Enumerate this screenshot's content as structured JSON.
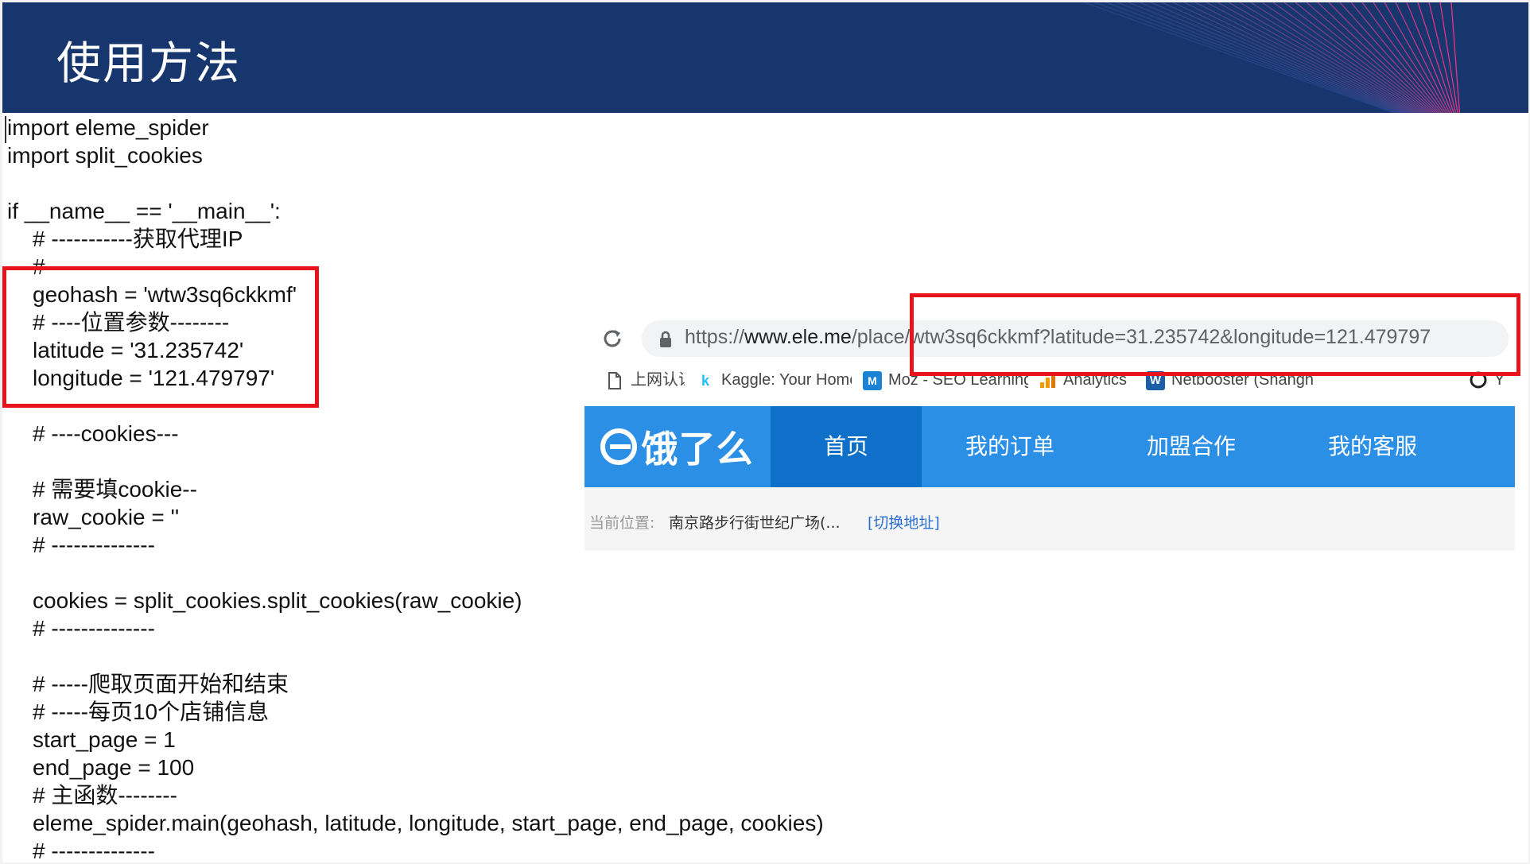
{
  "slide": {
    "title": "使用方法"
  },
  "code": {
    "lines": [
      {
        "text": "import eleme_spider",
        "indent": false
      },
      {
        "text": "import split_cookies",
        "indent": false
      },
      {
        "text": "",
        "indent": false
      },
      {
        "text": "if __name__ == '__main__':",
        "indent": false
      },
      {
        "text": "# -----------获取代理IP",
        "indent": true
      },
      {
        "text": "# -----------",
        "indent": true
      },
      {
        "text": "geohash = 'wtw3sq6ckkmf'",
        "indent": true
      },
      {
        "text": "# ----位置参数--------",
        "indent": true
      },
      {
        "text": "latitude = '31.235742'",
        "indent": true
      },
      {
        "text": "longitude = '121.479797'",
        "indent": true
      },
      {
        "text": "",
        "indent": true
      },
      {
        "text": "# ----cookies---",
        "indent": true
      },
      {
        "text": "",
        "indent": true
      },
      {
        "text": "# 需要填cookie--",
        "indent": true
      },
      {
        "text": "raw_cookie = ''",
        "indent": true
      },
      {
        "text": "# --------------",
        "indent": true
      },
      {
        "text": "",
        "indent": true
      },
      {
        "text": "cookies = split_cookies.split_cookies(raw_cookie)",
        "indent": true
      },
      {
        "text": "# --------------",
        "indent": true
      },
      {
        "text": "",
        "indent": true
      },
      {
        "text": "# -----爬取页面开始和结束",
        "indent": true
      },
      {
        "text": "# -----每页10个店铺信息",
        "indent": true
      },
      {
        "text": "start_page = 1",
        "indent": true
      },
      {
        "text": "end_page = 100",
        "indent": true
      },
      {
        "text": "# 主函数--------",
        "indent": true
      },
      {
        "text": "eleme_spider.main(geohash, latitude, longitude, start_page, end_page, cookies)",
        "indent": true
      },
      {
        "text": "# --------------",
        "indent": true
      }
    ]
  },
  "browser": {
    "url_scheme": "https://",
    "url_host": "www.ele.me",
    "url_path": "/place/wtw3sq6ckkmf?latitude=31.235742&longitude=121.479797",
    "bookmarks": [
      {
        "label": "上网认证",
        "icon": "page-icon"
      },
      {
        "label": "Kaggle: Your Home",
        "icon": "kaggle-icon"
      },
      {
        "label": "Moz - SEO Learning",
        "icon": "moz-icon"
      },
      {
        "label": "Analytics",
        "icon": "analytics-icon"
      },
      {
        "label": "Netbooster (Shangh",
        "icon": "netbooster-icon"
      },
      {
        "label": "Y",
        "icon": "github-icon"
      }
    ],
    "site": {
      "logo_text": "饿了么",
      "nav": [
        "首页",
        "我的订单",
        "加盟合作",
        "我的客服"
      ],
      "location_label": "当前位置:",
      "location_value": "南京路步行街世纪广场(...",
      "switch_link": "[切换地址]"
    }
  },
  "colors": {
    "header_bg": "#17366d",
    "highlight_red": "#e8141b",
    "site_nav_blue": "#2b8fe6",
    "site_nav_active": "#0e70c8"
  }
}
